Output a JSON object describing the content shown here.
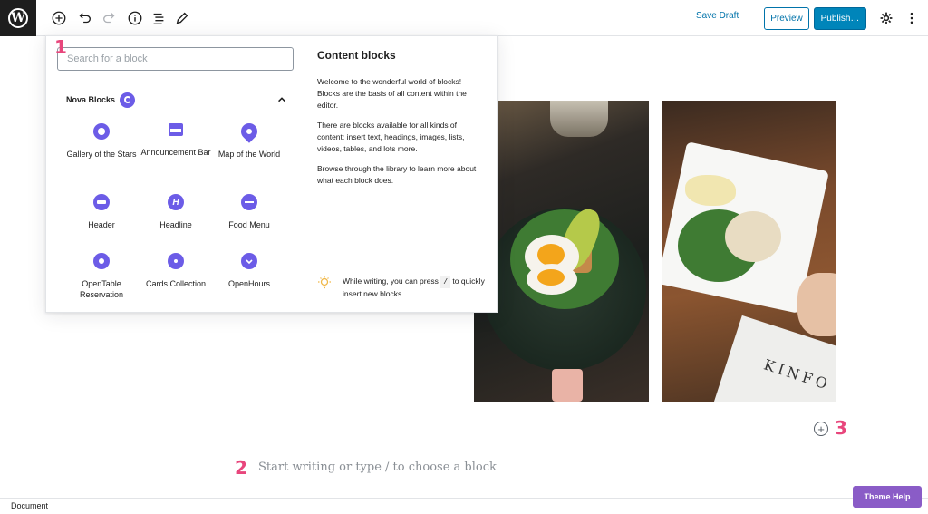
{
  "toolbar": {
    "logo_letter": "W",
    "save_draft": "Save Draft",
    "preview": "Preview",
    "publish": "Publish…"
  },
  "inserter": {
    "search_placeholder": "Search for a block",
    "panel_title": "Nova Blocks",
    "blocks": [
      {
        "label": "Gallery of the Stars",
        "icon": "gallery-icon"
      },
      {
        "label": "Announcement Bar",
        "icon": "announcement-icon"
      },
      {
        "label": "Map of the World",
        "icon": "map-pin-icon"
      },
      {
        "label": "Header",
        "icon": "header-icon"
      },
      {
        "label": "Headline",
        "icon": "headline-icon"
      },
      {
        "label": "Food Menu",
        "icon": "food-menu-icon"
      },
      {
        "label": "OpenTable Reservation",
        "icon": "opentable-icon"
      },
      {
        "label": "Cards Collection",
        "icon": "cards-icon"
      },
      {
        "label": "OpenHours",
        "icon": "clock-icon"
      }
    ],
    "info": {
      "title": "Content blocks",
      "paragraphs": [
        "Welcome to the wonderful world of blocks! Blocks are the basis of all content within the editor.",
        "There are blocks available for all kinds of content: insert text, headings, images, lists, videos, tables, and lots more.",
        "Browse through the library to learn more about what each block does."
      ],
      "tip_before": "While writing, you can press",
      "tip_key": "/",
      "tip_after": "to quickly insert new blocks."
    }
  },
  "editor": {
    "placeholder": "Start writing or type / to choose a block",
    "book_text": "KINFO"
  },
  "markers": {
    "one": "1",
    "two": "2",
    "three": "3"
  },
  "footer": {
    "document": "Document",
    "theme_help": "Theme Help"
  },
  "colors": {
    "accent": "#0085ba",
    "nova": "#6c5ce7",
    "marker": "#e8467c",
    "theme_help": "#8a5cc7"
  }
}
